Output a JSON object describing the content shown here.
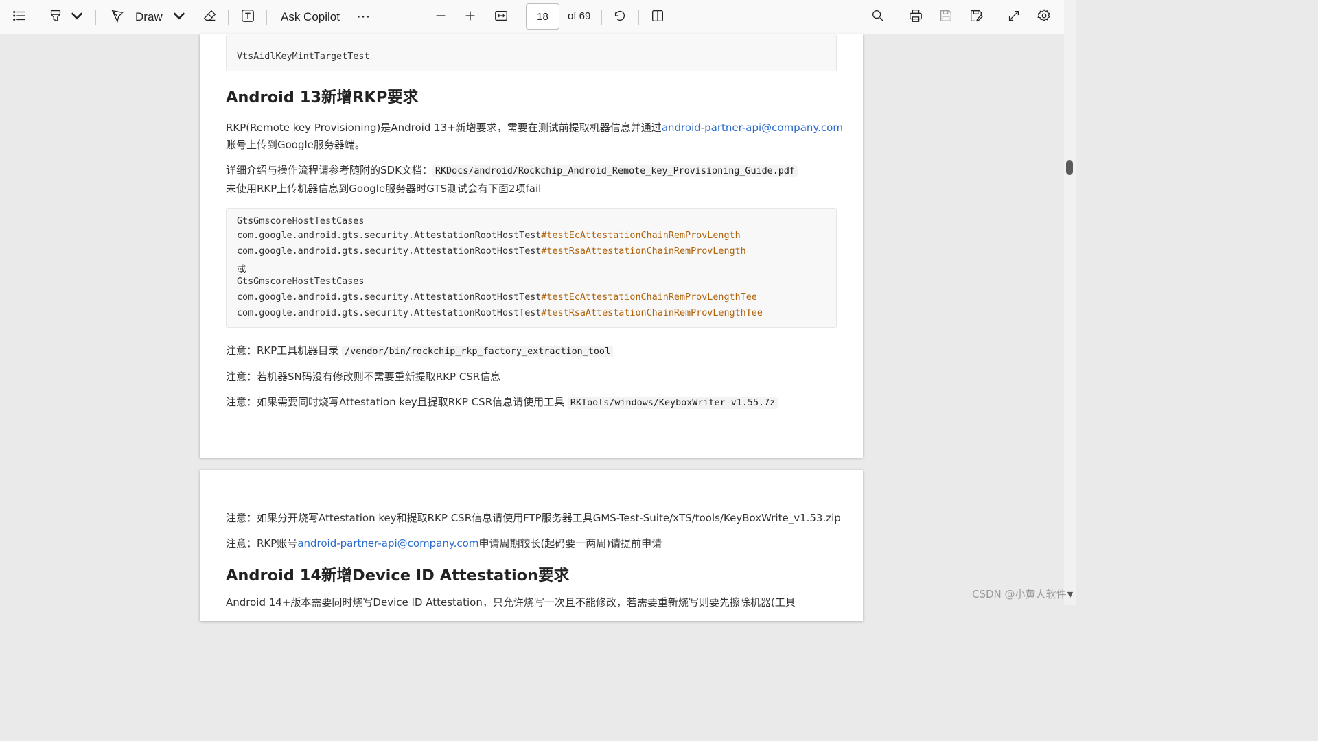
{
  "toolbar": {
    "draw_label": "Draw",
    "copilot_label": "Ask Copilot",
    "more_label": "···",
    "page_current": "18",
    "page_total": "of 69"
  },
  "page1": {
    "code_top": "VtsAidlKeyMintTargetTest",
    "heading_rkp": "Android 13新增RKP要求",
    "rkp_para1_a": "RKP(Remote key Provisioning)是Android 13+新增要求，需要在测试前提取机器信息并通过",
    "rkp_link": "android-partner-api@company.com",
    "rkp_para1_b": "账号上传到Google服务器端。",
    "rkp_doc_prefix": "详细介绍与操作流程请参考随附的SDK文档：",
    "rkp_doc_path": "RKDocs/android/Rockchip_Android_Remote_key_Provisioning_Guide.pdf",
    "rkp_fail_note": "未使用RKP上传机器信息到Google服务器时GTS测试会有下面2项fail",
    "code_lines": [
      {
        "plain": "GtsGmscoreHostTestCases",
        "hl": ""
      },
      {
        "plain": "com.google.android.gts.security.AttestationRootHostTest",
        "hl": "#testEcAttestationChainRemProvLength"
      },
      {
        "plain": "com.google.android.gts.security.AttestationRootHostTest",
        "hl": "#testRsaAttestationChainRemProvLength"
      },
      {
        "plain": "或",
        "hl": ""
      },
      {
        "plain": "GtsGmscoreHostTestCases",
        "hl": ""
      },
      {
        "plain": "com.google.android.gts.security.AttestationRootHostTest",
        "hl": "#testEcAttestationChainRemProvLengthTee"
      },
      {
        "plain": "com.google.android.gts.security.AttestationRootHostTest",
        "hl": "#testRsaAttestationChainRemProvLengthTee"
      }
    ],
    "note1_prefix": "注意：RKP工具机器目录 ",
    "note1_code": "/vendor/bin/rockchip_rkp_factory_extraction_tool",
    "note2": "注意：若机器SN码没有修改则不需要重新提取RKP CSR信息",
    "note3_prefix": "注意：如果需要同时烧写Attestation key且提取RKP CSR信息请使用工具 ",
    "note3_code": "RKTools/windows/KeyboxWriter-v1.55.7z"
  },
  "page2": {
    "note4": "注意：如果分开烧写Attestation key和提取RKP CSR信息请使用FTP服务器工具GMS-Test-Suite/xTS/tools/KeyBoxWrite_v1.53.zip",
    "note5_prefix": "注意：RKP账号",
    "note5_link": "android-partner-api@company.com",
    "note5_suffix": "申请周期较长(起码要一两周)请提前申请",
    "heading_device_id": "Android 14新增Device ID Attestation要求",
    "device_id_para": "Android 14+版本需要同时烧写Device ID Attestation，只允许烧写一次且不能修改，若需要重新烧写则要先擦除机器(工具"
  },
  "watermark": "CSDN @小黄人软件",
  "colors": {
    "link": "#2a6bcc",
    "code_highlight": "#b0620a",
    "page_background": "#eaeaea"
  }
}
